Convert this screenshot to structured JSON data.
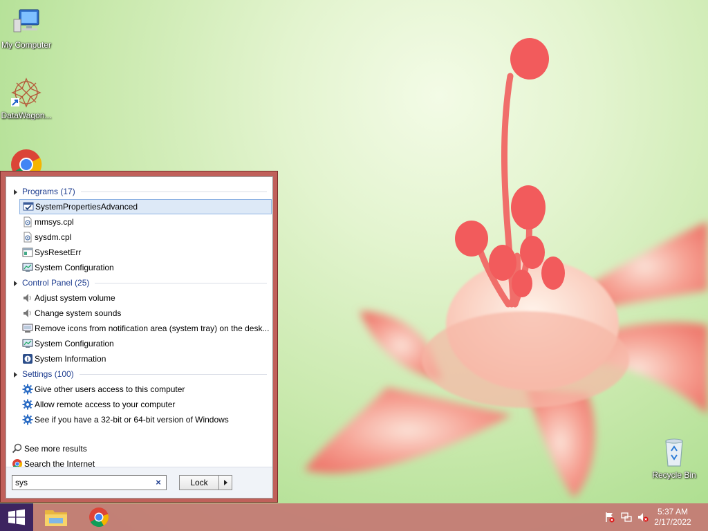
{
  "desktop": {
    "icons": [
      {
        "label": "My Computer",
        "icon": "computer-icon"
      },
      {
        "label": "DataWagon...",
        "icon": "datawagon-icon"
      },
      {
        "label": "",
        "icon": "chrome-icon"
      },
      {
        "label": "Recycle Bin",
        "icon": "recycle-bin-icon"
      }
    ]
  },
  "search": {
    "groups": [
      {
        "title": "Programs (17)",
        "items": [
          {
            "label": "SystemPropertiesAdvanced",
            "icon": "system-properties-icon",
            "selected": true
          },
          {
            "label": "mmsys.cpl",
            "icon": "cpl-file-icon"
          },
          {
            "label": "sysdm.cpl",
            "icon": "cpl-file-icon"
          },
          {
            "label": "SysResetErr",
            "icon": "app-window-icon"
          },
          {
            "label": "System Configuration",
            "icon": "system-config-icon"
          }
        ]
      },
      {
        "title": "Control Panel (25)",
        "items": [
          {
            "label": "Adjust system volume",
            "icon": "speaker-icon"
          },
          {
            "label": "Change system sounds",
            "icon": "speaker-icon"
          },
          {
            "label": "Remove icons from notification area (system tray) on the desk...",
            "icon": "monitor-icon"
          },
          {
            "label": "System Configuration",
            "icon": "system-config-icon"
          },
          {
            "label": "System Information",
            "icon": "system-info-icon"
          }
        ]
      },
      {
        "title": "Settings (100)",
        "items": [
          {
            "label": "Give other users access to this computer",
            "icon": "gear-icon"
          },
          {
            "label": "Allow remote access to your computer",
            "icon": "gear-icon"
          },
          {
            "label": "See if you have a 32-bit or 64-bit version of Windows",
            "icon": "gear-icon"
          }
        ]
      }
    ],
    "see_more": "See more results",
    "search_internet": "Search the Internet",
    "query": "sys",
    "clear_symbol": "×",
    "lock_label": "Lock"
  },
  "taskbar": {
    "apps": [
      {
        "name": "file-explorer"
      },
      {
        "name": "chrome"
      }
    ],
    "tray": [
      "flag-icon",
      "network-icon",
      "volume-muted-icon"
    ],
    "clock": {
      "time": "5:37 AM",
      "date": "2/17/2022"
    }
  },
  "colors": {
    "menu_frame": "#c0605a",
    "taskbar": "#c47874",
    "start_button": "#3d2460",
    "group_header": "#1e3d8f",
    "selection": "#dde9f7"
  }
}
